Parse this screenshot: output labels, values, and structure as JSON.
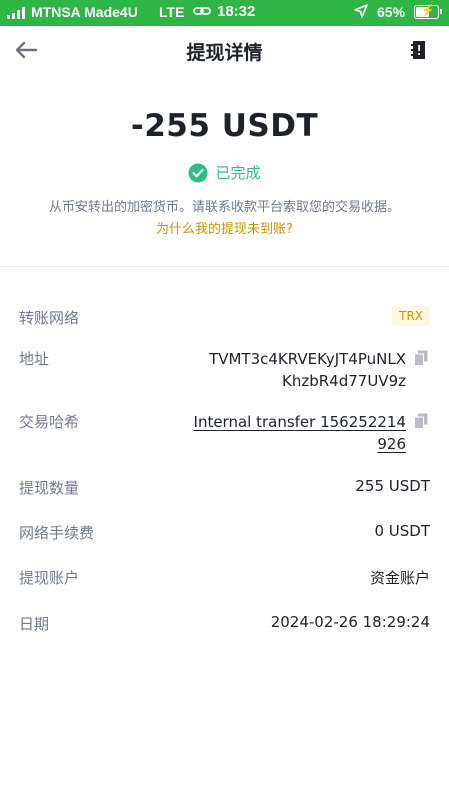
{
  "status_bar": {
    "carrier": "MTNSA Made4U",
    "network": "LTE",
    "time": "18:32",
    "battery": "65%",
    "battery_level": 0.65
  },
  "header": {
    "title": "提现详情"
  },
  "summary": {
    "amount": "-255 USDT",
    "status": "已完成",
    "notice": "从币安转出的加密货币。请联系收款平台索取您的交易收据。",
    "why_link": "为什么我的提现未到账?"
  },
  "details": {
    "network_label": "转账网络",
    "network_value": "TRX",
    "address_label": "地址",
    "address_line1": "TVMT3c4KRVEKyJT4PuNLX",
    "address_line2": "KhzbR4d77UV9z",
    "txid_label": "交易哈希",
    "txid_line1": "Internal transfer 156252214",
    "txid_line2": "926",
    "amount_label": "提现数量",
    "amount_value": "255 USDT",
    "fee_label": "网络手续费",
    "fee_value": "0 USDT",
    "account_label": "提现账户",
    "account_value": "资金账户",
    "date_label": "日期",
    "date_value": "2024-02-26 18:29:24"
  },
  "colors": {
    "status_bar": "#2fb544",
    "success": "#2ebd85",
    "accent": "#c99400",
    "text": "#1e2329",
    "muted": "#707a8a"
  }
}
